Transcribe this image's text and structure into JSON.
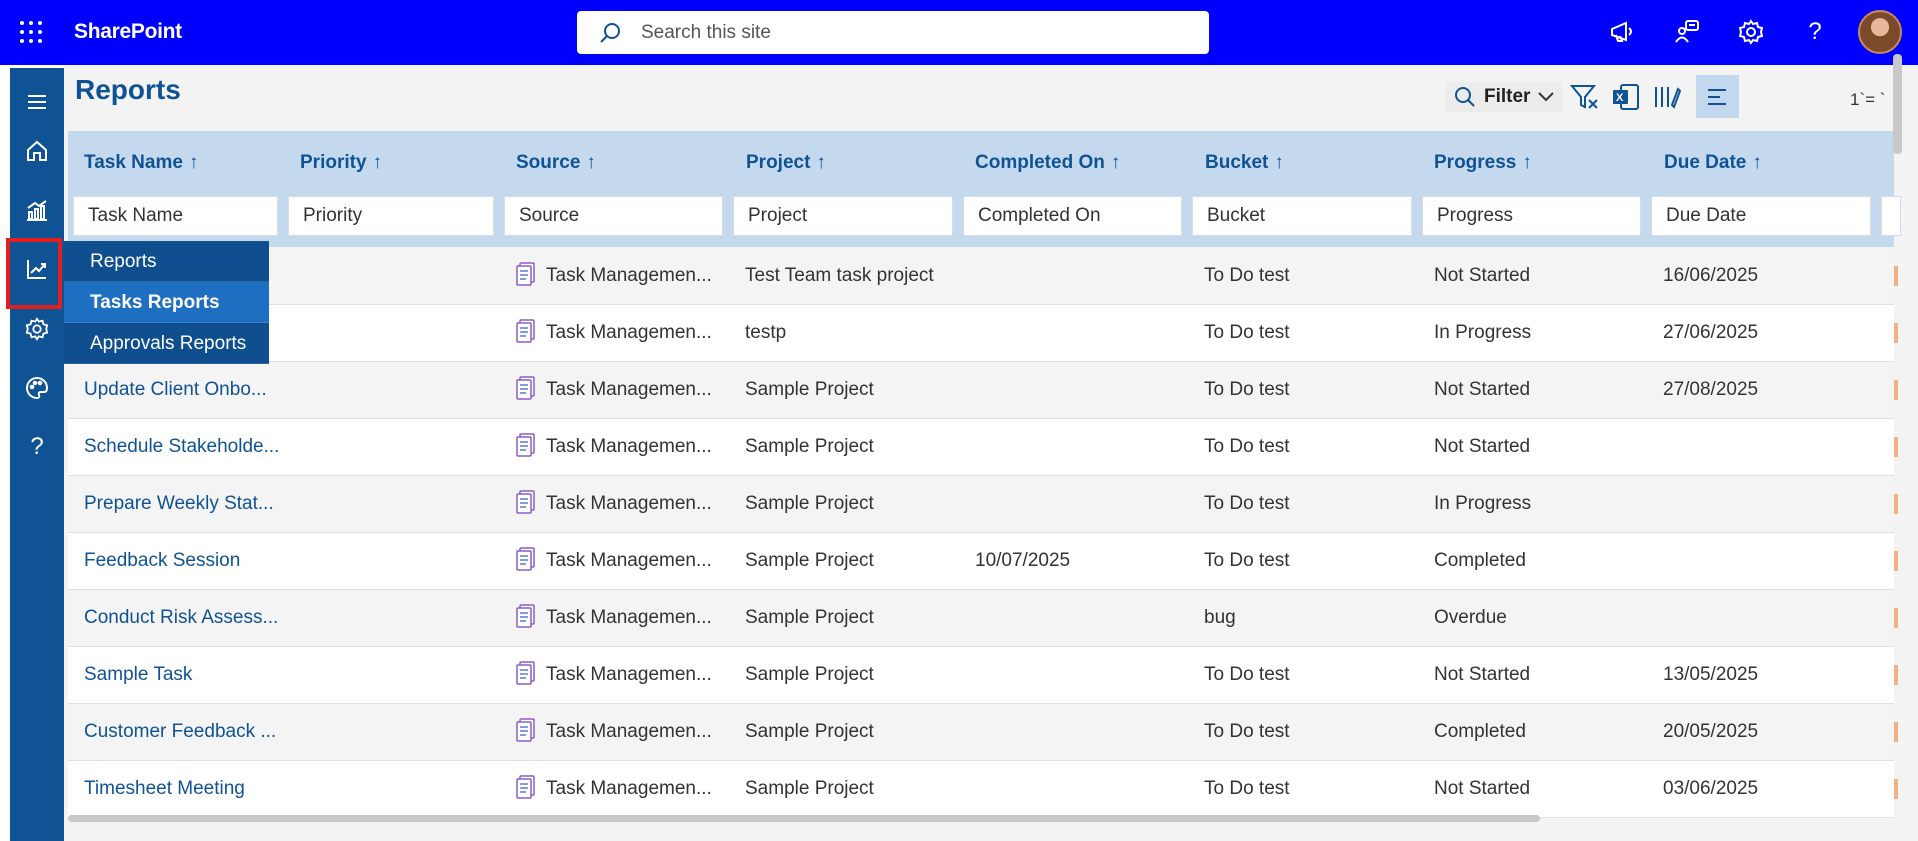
{
  "topbar": {
    "brand": "SharePoint",
    "search_placeholder": "Search this site",
    "icons": [
      "waffle-icon",
      "megaphone-icon",
      "people-network-icon",
      "gear-icon",
      "help-icon"
    ]
  },
  "leftrail": {
    "icons": [
      "hamburger-icon",
      "home-icon",
      "analytics-icon",
      "trend-chart-icon",
      "settings-icon",
      "palette-icon",
      "help-icon"
    ],
    "selected": "trend-chart-icon",
    "flyout": [
      "Reports",
      "Tasks Reports",
      "Approvals Reports"
    ],
    "flyout_active": "Tasks Reports"
  },
  "page": {
    "title": "Reports",
    "filter_label": "Filter",
    "overflow_text": "1`= `"
  },
  "table": {
    "columns": [
      {
        "label": "Task Name",
        "arrow": "↑",
        "filter": "Task Name"
      },
      {
        "label": "Priority",
        "arrow": "↑",
        "filter": "Priority"
      },
      {
        "label": "Source",
        "arrow": "↑",
        "filter": "Source"
      },
      {
        "label": "Project",
        "arrow": "↑",
        "filter": "Project"
      },
      {
        "label": "Completed On",
        "arrow": "↑",
        "filter": "Completed On"
      },
      {
        "label": "Bucket",
        "arrow": "↑",
        "filter": "Bucket"
      },
      {
        "label": "Progress",
        "arrow": "↑",
        "filter": "Progress"
      },
      {
        "label": "Due Date",
        "arrow": "↑",
        "filter": "Due Date"
      }
    ],
    "rows": [
      {
        "task": "",
        "priority": "",
        "source": "Task Managemen...",
        "project": "Test Team task project",
        "completed": "",
        "bucket": "To Do test",
        "progress": "Not Started",
        "due": "16/06/2025"
      },
      {
        "task": "",
        "priority": "",
        "source": "Task Managemen...",
        "project": "testp",
        "completed": "",
        "bucket": "To Do test",
        "progress": "In Progress",
        "due": "27/06/2025"
      },
      {
        "task": "Update Client Onbo...",
        "priority": "",
        "source": "Task Managemen...",
        "project": "Sample Project",
        "completed": "",
        "bucket": "To Do test",
        "progress": "Not Started",
        "due": "27/08/2025"
      },
      {
        "task": "Schedule Stakeholde...",
        "priority": "",
        "source": "Task Managemen...",
        "project": "Sample Project",
        "completed": "",
        "bucket": "To Do test",
        "progress": "Not Started",
        "due": ""
      },
      {
        "task": "Prepare Weekly Stat...",
        "priority": "",
        "source": "Task Managemen...",
        "project": "Sample Project",
        "completed": "",
        "bucket": "To Do test",
        "progress": "In Progress",
        "due": ""
      },
      {
        "task": "Feedback Session",
        "priority": "",
        "source": "Task Managemen...",
        "project": "Sample Project",
        "completed": "10/07/2025",
        "bucket": "To Do test",
        "progress": "Completed",
        "due": ""
      },
      {
        "task": "Conduct Risk Assess...",
        "priority": "",
        "source": "Task Managemen...",
        "project": "Sample Project",
        "completed": "",
        "bucket": "bug",
        "progress": "Overdue",
        "due": ""
      },
      {
        "task": "Sample Task",
        "priority": "",
        "source": "Task Managemen...",
        "project": "Sample Project",
        "completed": "",
        "bucket": "To Do test",
        "progress": "Not Started",
        "due": "13/05/2025"
      },
      {
        "task": "Customer Feedback ...",
        "priority": "",
        "source": "Task Managemen...",
        "project": "Sample Project",
        "completed": "",
        "bucket": "To Do test",
        "progress": "Completed",
        "due": "20/05/2025"
      },
      {
        "task": "Timesheet Meeting",
        "priority": "",
        "source": "Task Managemen...",
        "project": "Sample Project",
        "completed": "",
        "bucket": "To Do test",
        "progress": "Not Started",
        "due": "03/06/2025"
      }
    ]
  },
  "colors": {
    "suite_bar": "#0000ff",
    "rail": "#0f5395",
    "accent_text": "#0f5395",
    "header_band": "#c5d9ee",
    "selected_outline": "#e02020",
    "flyout_active": "#1e6fc1"
  }
}
